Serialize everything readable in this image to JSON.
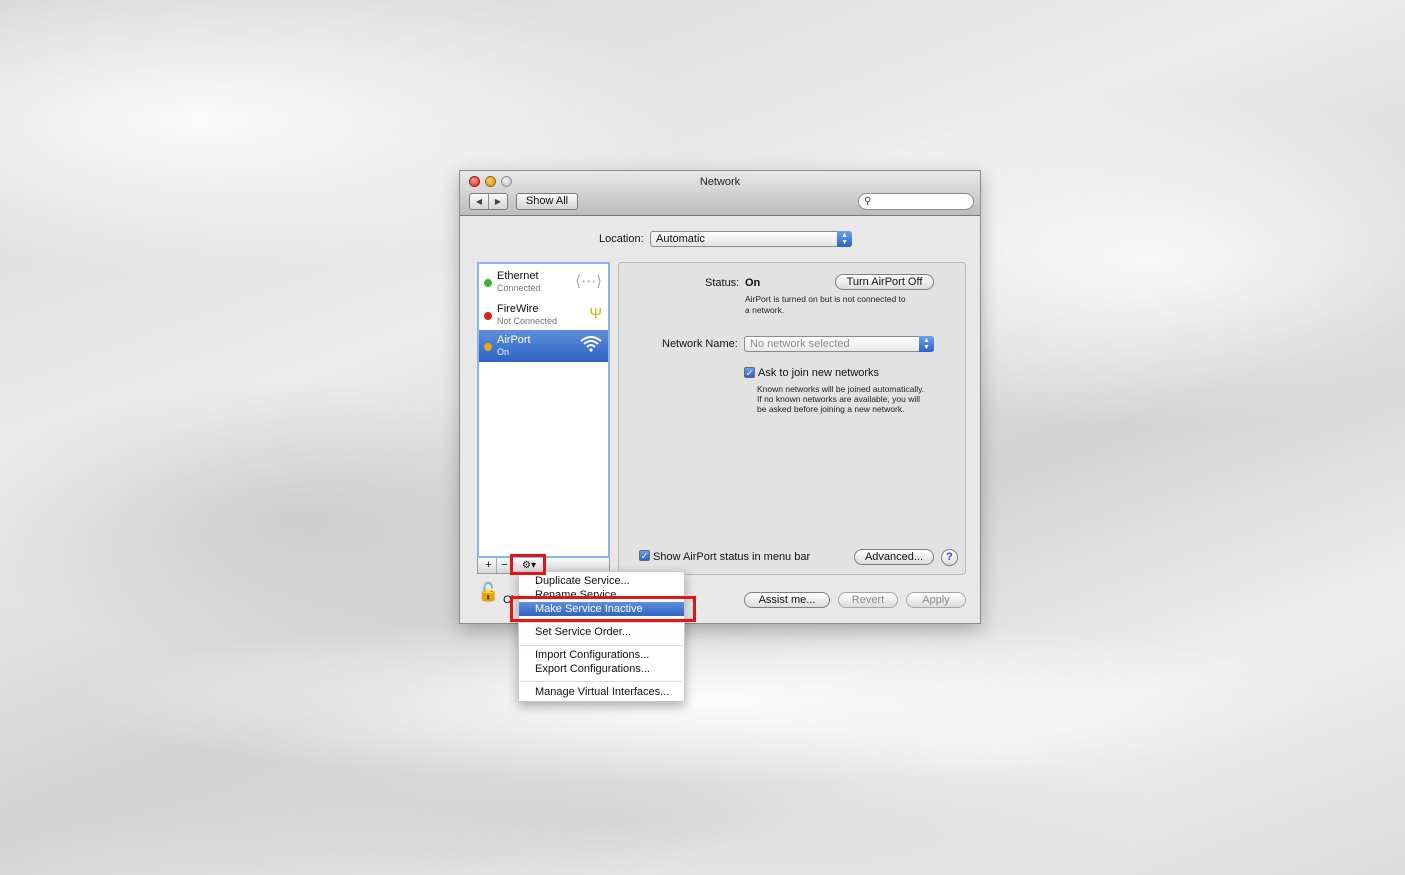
{
  "window": {
    "title": "Network",
    "nav_back": "◀",
    "nav_forward": "▶",
    "show_all": "Show All",
    "search_placeholder": ""
  },
  "location": {
    "label": "Location:",
    "value": "Automatic"
  },
  "services": [
    {
      "name": "Ethernet",
      "status": "Connected",
      "status_color": "#3fb533",
      "icon": "ethernet-arrows-icon",
      "selected": false
    },
    {
      "name": "FireWire",
      "status": "Not Connected",
      "status_color": "#d6241c",
      "icon": "firewire-icon",
      "selected": false
    },
    {
      "name": "AirPort",
      "status": "On",
      "status_color": "#e9a81a",
      "icon": "wifi-icon",
      "selected": true
    }
  ],
  "service_toolbar": {
    "add": "+",
    "remove": "−",
    "gear": "⚙▾"
  },
  "detail": {
    "status_label": "Status:",
    "status_value": "On",
    "turn_off_button": "Turn AirPort Off",
    "status_desc_1": "AirPort is turned on but is not connected to",
    "status_desc_2": "a network.",
    "network_name_label": "Network Name:",
    "network_name_value": "No network selected",
    "ask_join_label": "Ask to join new networks",
    "ask_join_desc_1": "Known networks will be joined automatically.",
    "ask_join_desc_2": "If no known networks are available, you will",
    "ask_join_desc_3": "be asked before joining a new network.",
    "show_status_label": "Show AirPort status in menu bar",
    "advanced_button": "Advanced...",
    "help_button": "?"
  },
  "bottom": {
    "lock_text": "Cl",
    "assist_button": "Assist me...",
    "revert_button": "Revert",
    "apply_button": "Apply"
  },
  "context_menu": {
    "items": [
      "Duplicate Service...",
      "Rename Service...",
      "Make Service Inactive",
      "Set Service Order...",
      "Import Configurations...",
      "Export Configurations...",
      "Manage Virtual Interfaces..."
    ],
    "highlighted_index": 2
  },
  "colors": {
    "selection_blue": "#2d63c6",
    "annotation_red": "#e21414"
  }
}
